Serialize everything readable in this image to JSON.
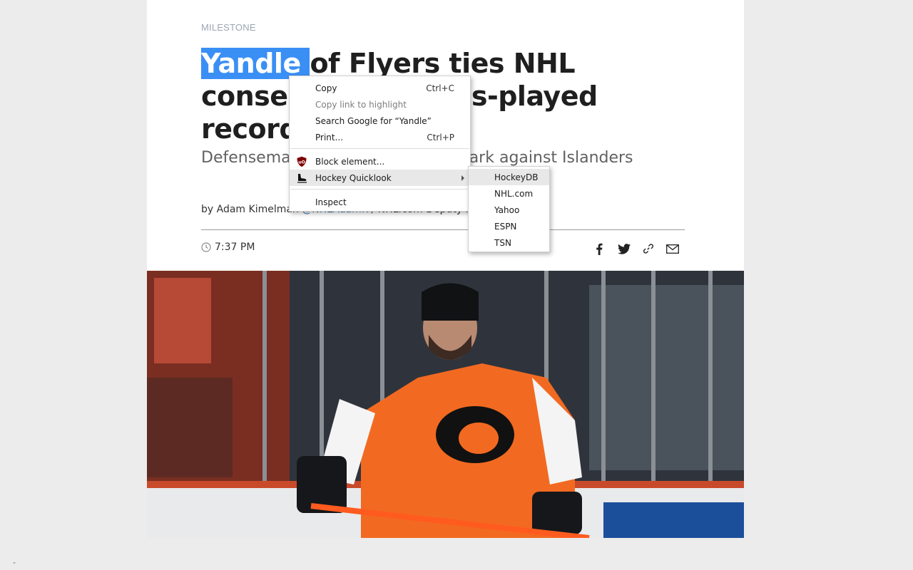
{
  "article": {
    "category": "MILESTONE",
    "headline_selected": "Yandle ",
    "headline_rest": "of Flyers ties NHL consecutive games-played record at 964",
    "subhead": "Defenseman can pass Jarvis for mark against Islanders",
    "byline_prefix": "by Adam Kimelman ",
    "byline_handle": "@NHLAdamK",
    "byline_suffix": " / NHL.com Deputy Managing Editor",
    "time": "7:37 PM"
  },
  "share": {
    "icons": [
      "facebook-icon",
      "twitter-icon",
      "link-icon",
      "email-icon"
    ]
  },
  "context_menu": {
    "items": [
      {
        "label": "Copy",
        "shortcut": "Ctrl+C"
      },
      {
        "label": "Copy link to highlight",
        "shortcut": ""
      },
      {
        "label": "Search Google for “Yandle”",
        "shortcut": ""
      },
      {
        "label": "Print...",
        "shortcut": "Ctrl+P"
      },
      {
        "label": "Block element...",
        "shortcut": ""
      },
      {
        "label": "Hockey Quicklook",
        "shortcut": ""
      },
      {
        "label": "Inspect",
        "shortcut": ""
      }
    ]
  },
  "submenu": {
    "items": [
      "HockeyDB",
      "NHL.com",
      "Yahoo",
      "ESPN",
      "TSN"
    ]
  },
  "colors": {
    "selection": "#3a8ff5",
    "flyers_orange": "#f26a21",
    "menu_hover": "#e8e8e8"
  },
  "corner_text": "-"
}
